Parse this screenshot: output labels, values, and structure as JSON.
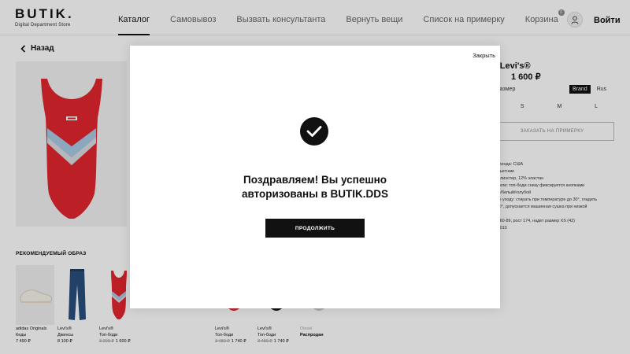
{
  "header": {
    "logo": "BUTIK.",
    "logo_subtitle": "Digital Department Store",
    "nav": [
      {
        "label": "Каталог",
        "active": true
      },
      {
        "label": "Самовывоз",
        "active": false
      },
      {
        "label": "Вызвать консультанта",
        "active": false
      },
      {
        "label": "Вернуть вещи",
        "active": false
      },
      {
        "label": "Список на примерку",
        "active": false
      },
      {
        "label": "Корзина",
        "active": false
      }
    ],
    "cart_count": "0",
    "login_label": "Войти"
  },
  "page": {
    "back_label": "Назад",
    "product_title": "ди Levi's®",
    "product_price": "1 600 ₽",
    "size_label": "е размер",
    "size_toggle": [
      "Brand",
      "Rus"
    ],
    "sizes": [
      "S",
      "M",
      "L"
    ],
    "order_button": "ЗАКАЗАТЬ НА ПРИМЕРКУ",
    "details": [
      "s®",
      "ана бренда: США",
      "тво: Вьетнам",
      "8% полиэстер, 12% эластан",
      "и модели: топ-боди снизу фиксируется кнопками",
      "асный/белый/голубой",
      "ции по уходу: стирать при температуре до 30°, гладить",
      "до 150°, допускается машинная сушка при низкой",
      "е",
      "ы: 82-60-89, рост 174, надет размер XS (42)",
      "11200010"
    ],
    "reco_title": "РЕКОМЕНДУЕМЫЙ ОБРАЗ",
    "reco_items": [
      {
        "brand": "adidas Originals",
        "name": "Кеды",
        "price": "7 490 ₽",
        "old_price": ""
      },
      {
        "brand": "Levi's®",
        "name": "Джинсы",
        "price": "8 100 ₽",
        "old_price": ""
      },
      {
        "brand": "Levi's®",
        "name": "Топ-боди",
        "price": "1 600 ₽",
        "old_price": "3 200 ₽"
      }
    ],
    "similar_items": [
      {
        "brand": "Levi's®",
        "name": "Топ-боди",
        "price": "1 740 ₽",
        "old_price": "3 480 ₽"
      },
      {
        "brand": "Levi's®",
        "name": "Топ-боди",
        "price": "1 740 ₽",
        "old_price": "3 480 ₽"
      },
      {
        "brand": "Diesel",
        "name": "Распродан",
        "price": "",
        "old_price": ""
      }
    ]
  },
  "modal": {
    "close_label": "Закрыть",
    "message_line1": "Поздравляем! Вы успешно",
    "message_line2": "авторизованы в BUTIK.DDS",
    "continue_label": "ПРОДОЛЖИТЬ"
  },
  "colors": {
    "accent": "#111111",
    "product_red": "#e3262e",
    "product_blue": "#a8cbe6"
  }
}
